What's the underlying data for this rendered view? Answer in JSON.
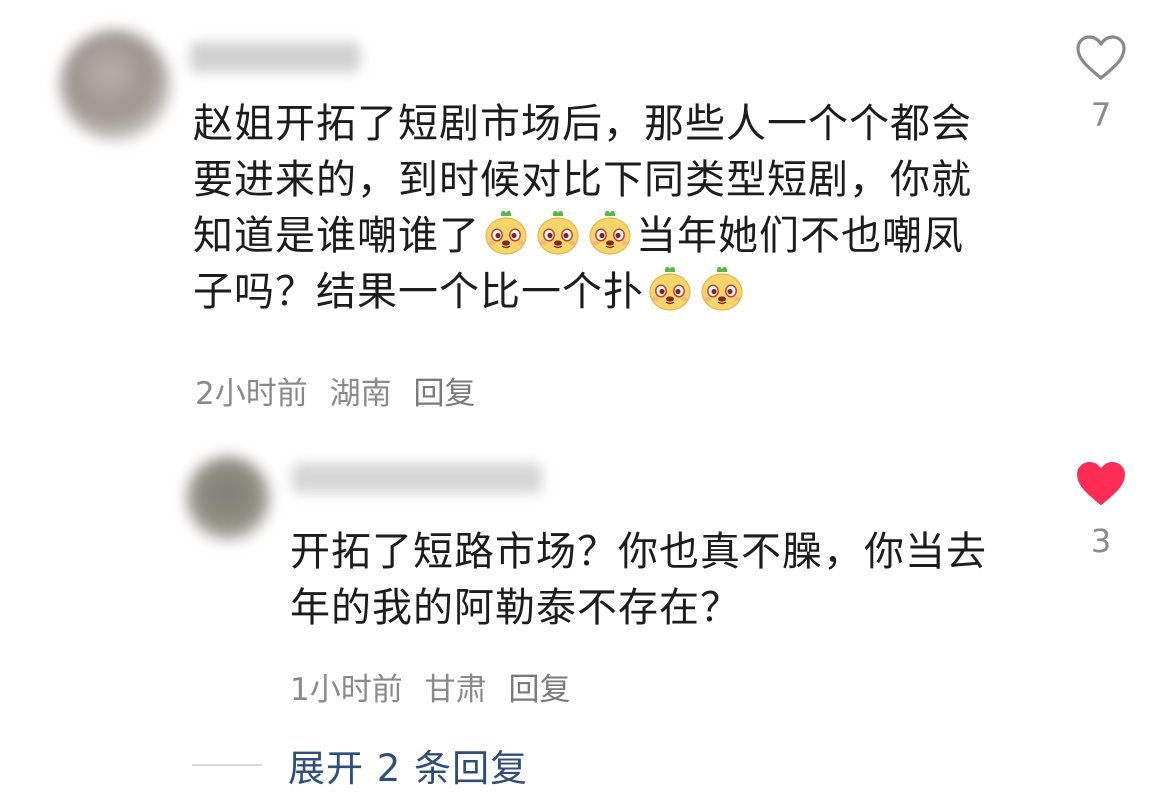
{
  "comment": {
    "text_lines": [
      "赵姐开拓了短剧市场后，那些人一个个都会",
      "要进来的，到时候对比下同类型短剧，你就",
      "知道是谁嘲谁了",
      "当年她们不也嘲凤",
      "子吗？结果一个比一个扑"
    ],
    "time": "2小时前",
    "location": "湖南",
    "reply_label": "回复",
    "like_count": "7",
    "liked": false,
    "emoji_icon": "dog-face-emoji"
  },
  "reply": {
    "text_lines": [
      "开拓了短路市场？你也真不臊，你当去",
      "年的我的阿勒泰不存在？"
    ],
    "time": "1小时前",
    "location": "甘肃",
    "reply_label": "回复",
    "like_count": "3",
    "liked": true
  },
  "expand_replies_label": "展开 2 条回复",
  "colors": {
    "liked_heart": "#ff2d55",
    "meta_text": "#8a8a8a",
    "expand_link": "#2f4f7a"
  }
}
